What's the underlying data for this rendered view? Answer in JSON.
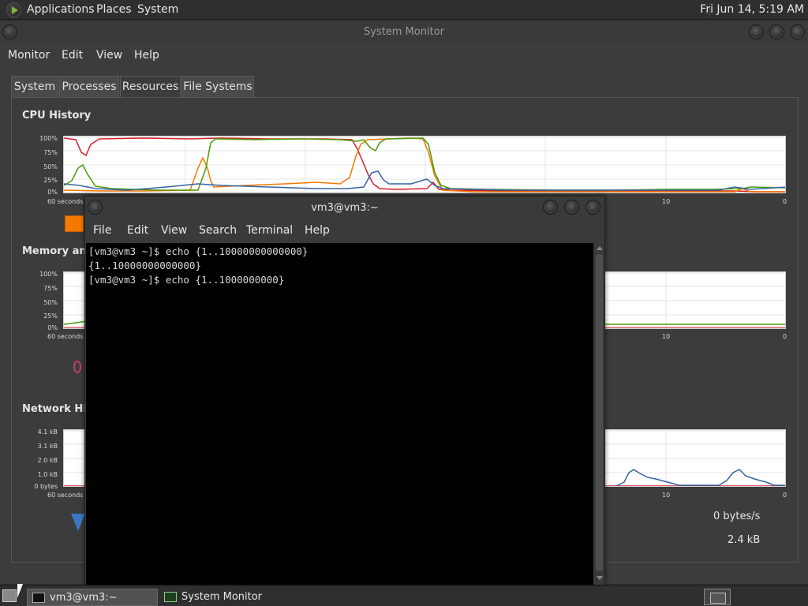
{
  "top_panel": {
    "menus": [
      "Applications",
      "Places",
      "System"
    ],
    "clock": "Fri Jun 14,  5:19 AM"
  },
  "system_monitor": {
    "title": "System Monitor",
    "menubar": [
      "Monitor",
      "Edit",
      "View",
      "Help"
    ],
    "tabs": [
      "System",
      "Processes",
      "Resources",
      "File Systems"
    ],
    "active_tab": "Resources",
    "cpu": {
      "title": "CPU History",
      "y_ticks": [
        "100%",
        "75%",
        "50%",
        "25%",
        "0%"
      ],
      "x_start": "60 seconds",
      "x_ticks": [
        "10",
        "0"
      ],
      "colors": [
        "#d81f2b",
        "#f57900",
        "#4e9a06",
        "#3465a4"
      ]
    },
    "memory": {
      "title": "Memory and",
      "y_ticks": [
        "100%",
        "75%",
        "50%",
        "25%",
        "0%"
      ],
      "x_start": "60 seconds",
      "x_ticks": [
        "10",
        "0"
      ]
    },
    "network": {
      "title": "Network Hist",
      "y_ticks": [
        "4.1 kB",
        "3.1 kB",
        "2.0 kB",
        "1.0 kB",
        "0 bytes"
      ],
      "x_start": "60 seconds",
      "x_ticks": [
        "10",
        "0"
      ],
      "rate": "0 bytes/s",
      "total": "2.4 kB"
    }
  },
  "terminal": {
    "title": "vm3@vm3:~",
    "menubar": [
      "File",
      "Edit",
      "View",
      "Search",
      "Terminal",
      "Help"
    ],
    "lines": [
      "[vm3@vm3 ~]$ echo {1..10000000000000}",
      "{1..10000000000000}",
      "[vm3@vm3 ~]$ echo {1..1000000000}"
    ]
  },
  "taskbar": {
    "tasks": [
      "vm3@vm3:~",
      "System Monitor"
    ],
    "active_task": "vm3@vm3:~"
  }
}
